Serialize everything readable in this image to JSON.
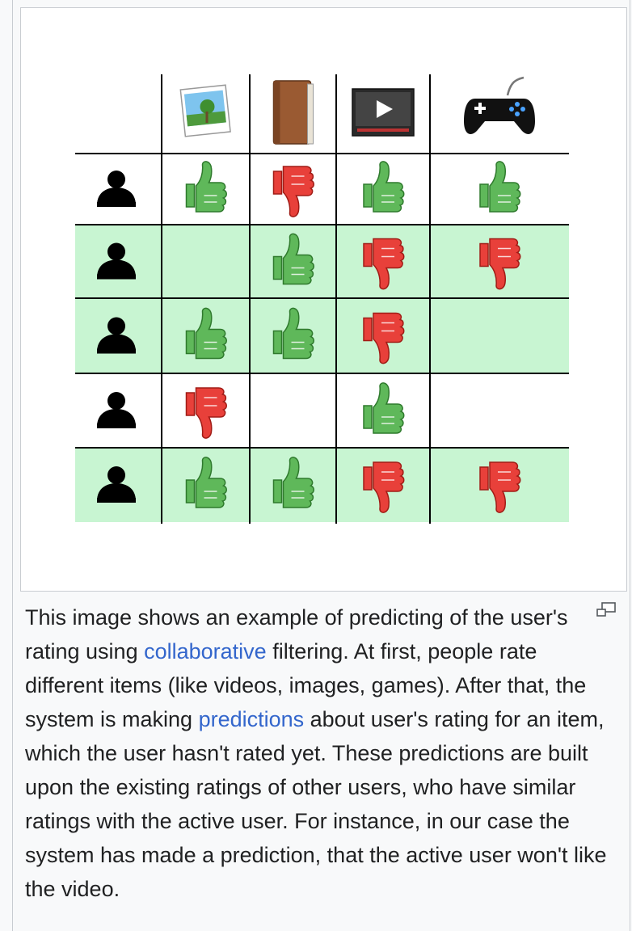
{
  "figure": {
    "item_icons": [
      "photo-icon",
      "book-icon",
      "video-icon",
      "gamepad-icon"
    ],
    "user_icon": "user-silhouette-icon",
    "shaded_rows": [
      1,
      2,
      4
    ],
    "ratings": [
      [
        "up",
        "down",
        "up",
        "up"
      ],
      [
        "",
        "up",
        "down",
        "down"
      ],
      [
        "up",
        "up",
        "down",
        ""
      ],
      [
        "down",
        "",
        "up",
        ""
      ],
      [
        "up",
        "up",
        "down",
        "down"
      ]
    ],
    "colors": {
      "row_shade": "#c8f5d2",
      "thumb_up": "#5fb85a",
      "thumb_down": "#e8403a",
      "grid": "#000000"
    }
  },
  "caption": {
    "text_1": "This image shows an example of predicting of the user's rating using ",
    "link_1": "collaborative",
    "text_2": " filtering. At first, people rate different items (like videos, images, games). After that, the system is making ",
    "link_2": "predictions",
    "text_3": " about user's rating for an item, which the user hasn't rated yet. These predictions are built upon the existing ratings of other users, who have similar ratings with the active user. For instance, in our case the system has made a prediction, that the active user won't like the video."
  },
  "magnify_icon": "enlarge-icon"
}
